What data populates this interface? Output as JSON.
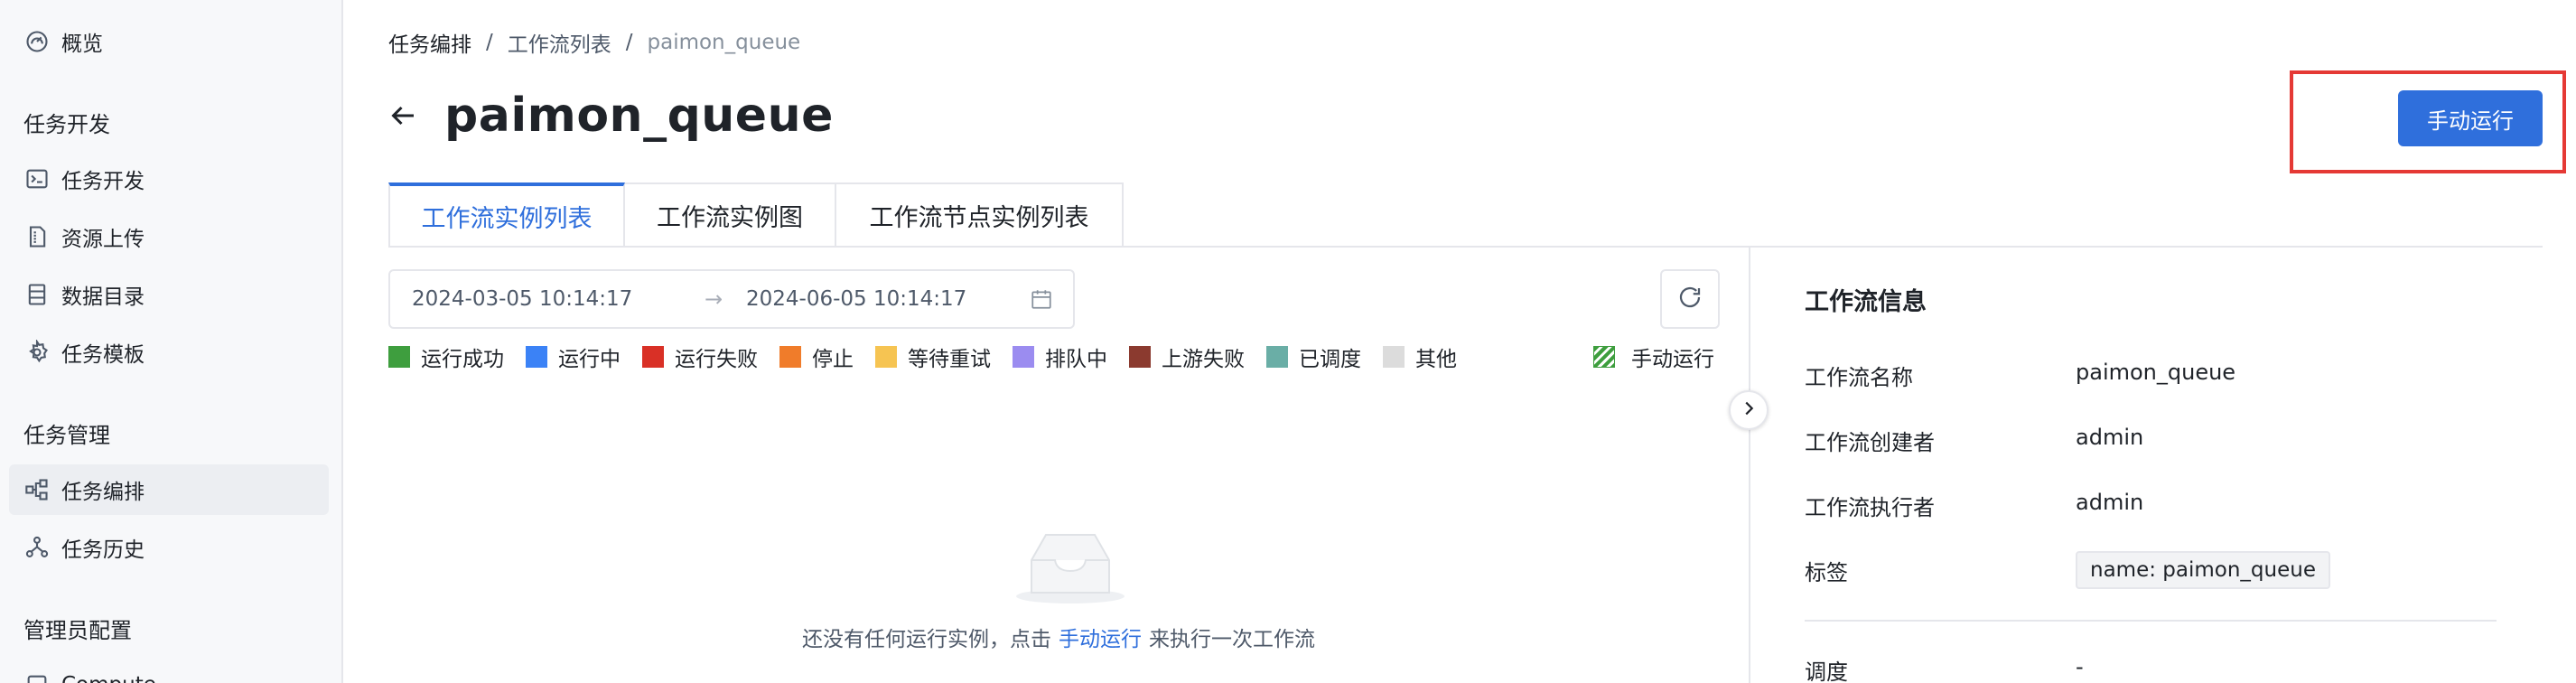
{
  "sidebar": {
    "overview": "概览",
    "group_dev": "任务开发",
    "dev_items": [
      {
        "label": "任务开发",
        "icon": "terminal-icon"
      },
      {
        "label": "资源上传",
        "icon": "file-upload-icon"
      },
      {
        "label": "数据目录",
        "icon": "table-icon"
      },
      {
        "label": "任务模板",
        "icon": "gear-icon"
      }
    ],
    "group_manage": "任务管理",
    "manage_items": [
      {
        "label": "任务编排",
        "icon": "flow-icon"
      },
      {
        "label": "任务历史",
        "icon": "history-icon"
      }
    ],
    "group_admin": "管理员配置",
    "admin_items": [
      {
        "label": "Compute",
        "icon": "compute-icon"
      }
    ]
  },
  "breadcrumb": [
    "任务编排",
    "工作流列表",
    "paimon_queue"
  ],
  "page_title": "paimon_queue",
  "run_button": "手动运行",
  "tabs": [
    "工作流实例列表",
    "工作流实例图",
    "工作流节点实例列表"
  ],
  "date_range": {
    "start": "2024-03-05 10:14:17",
    "separator": "→",
    "end": "2024-06-05 10:14:17"
  },
  "legend": [
    {
      "label": "运行成功",
      "color": "#3e9e3e"
    },
    {
      "label": "运行中",
      "color": "#3b82f6"
    },
    {
      "label": "运行失败",
      "color": "#d93026"
    },
    {
      "label": "停止",
      "color": "#f07c2a"
    },
    {
      "label": "等待重试",
      "color": "#f6c452"
    },
    {
      "label": "排队中",
      "color": "#9b8cf0"
    },
    {
      "label": "上游失败",
      "color": "#8b3a2f"
    },
    {
      "label": "已调度",
      "color": "#6aaea6"
    },
    {
      "label": "其他",
      "color": "#dcdcdc"
    }
  ],
  "legend_manual": "手动运行",
  "empty_state": {
    "prefix": "还没有任何运行实例，点击",
    "link": "手动运行",
    "suffix": "来执行一次工作流"
  },
  "info_panel": {
    "title": "工作流信息",
    "name_label": "工作流名称",
    "name_value": "paimon_queue",
    "creator_label": "工作流创建者",
    "creator_value": "admin",
    "executor_label": "工作流执行者",
    "executor_value": "admin",
    "tag_label": "标签",
    "tag_value": "name: paimon_queue",
    "schedule_label": "调度",
    "schedule_value": "-"
  }
}
